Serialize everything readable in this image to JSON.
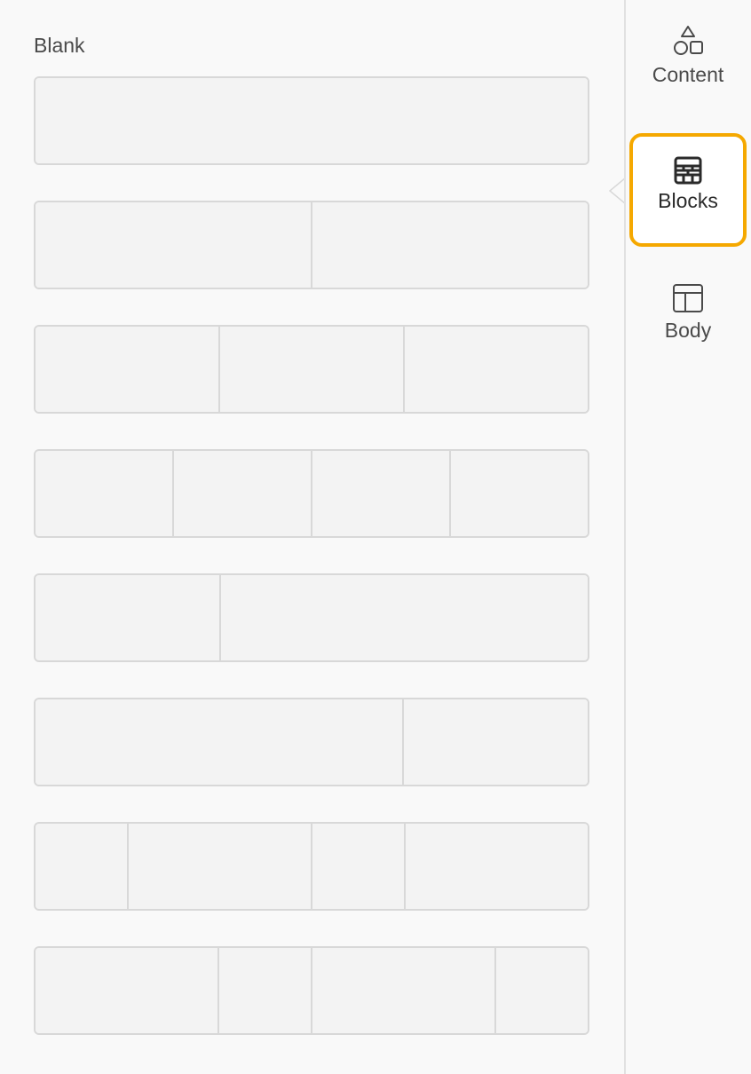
{
  "main": {
    "section_label": "Blank",
    "layouts": [
      {
        "name": "1-column",
        "columns": [
          1
        ]
      },
      {
        "name": "2-columns-equal",
        "columns": [
          1,
          1
        ]
      },
      {
        "name": "3-columns-equal",
        "columns": [
          1,
          1,
          1
        ]
      },
      {
        "name": "4-columns-equal",
        "columns": [
          1,
          1,
          1,
          1
        ]
      },
      {
        "name": "1-3-2-3",
        "columns": [
          1,
          2
        ]
      },
      {
        "name": "2-3-1-3",
        "columns": [
          2,
          1
        ]
      },
      {
        "name": "1-2-1-2",
        "columns": [
          1,
          2,
          1,
          2
        ]
      },
      {
        "name": "2-1-2-1",
        "columns": [
          2,
          1,
          2,
          1
        ]
      }
    ]
  },
  "sidebar": {
    "items": [
      {
        "label": "Content",
        "icon": "shapes-icon",
        "active": false
      },
      {
        "label": "Blocks",
        "icon": "blocks-icon",
        "active": true
      },
      {
        "label": "Body",
        "icon": "layout-icon",
        "active": false
      }
    ]
  },
  "colors": {
    "accent": "#f5a800",
    "cell_bg": "#f3f3f3",
    "cell_border": "#d8d8d8",
    "text": "#4a4a4a"
  }
}
